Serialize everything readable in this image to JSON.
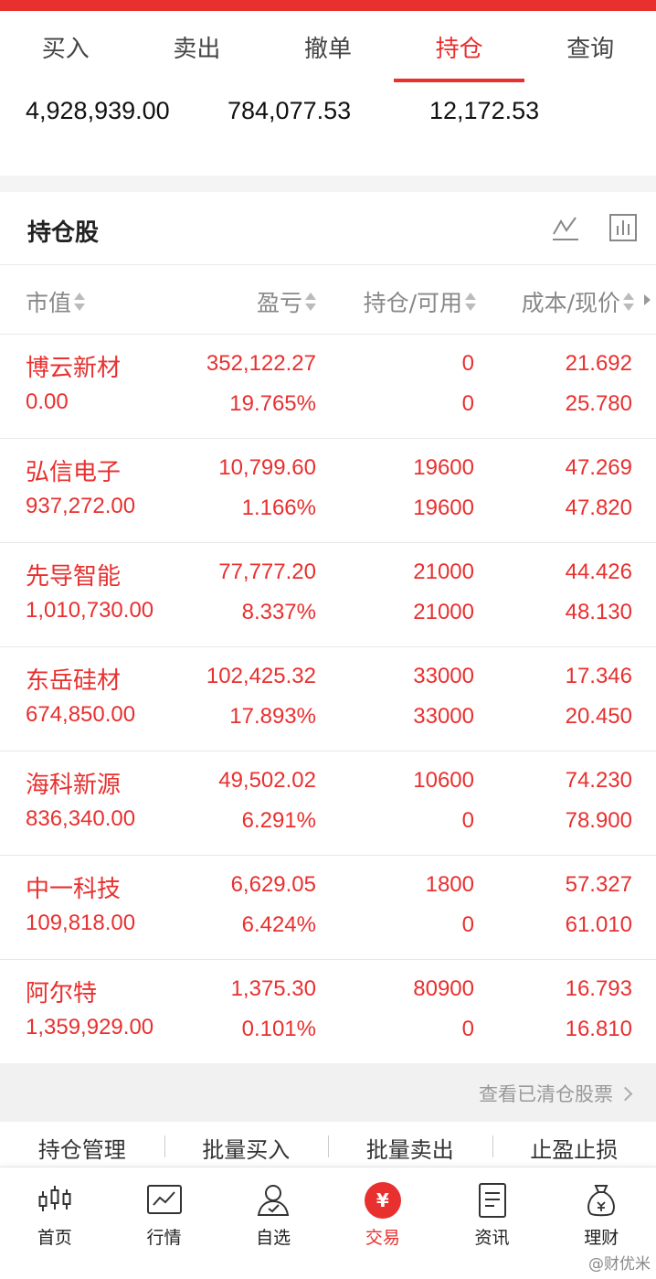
{
  "accent_color": "#e8302f",
  "tabs": [
    {
      "label": "买入"
    },
    {
      "label": "卖出"
    },
    {
      "label": "撤单"
    },
    {
      "label": "持仓",
      "active": true
    },
    {
      "label": "查询"
    }
  ],
  "summary": {
    "total_assets": "4,928,939.00",
    "market_value": "784,077.53",
    "available": "12,172.53"
  },
  "holdings": {
    "title": "持仓股",
    "icons": [
      "line-chart-icon",
      "bar-chart-icon"
    ]
  },
  "columns": {
    "market_value": "市值",
    "profit_loss": "盈亏",
    "position": "持仓/可用",
    "cost_price": "成本/现价"
  },
  "rows": [
    {
      "name": "博云新材",
      "market_value": "0.00",
      "pl": "352,122.27",
      "pl_pct": "19.765%",
      "position": "0",
      "available": "0",
      "cost": "21.692",
      "price": "25.780"
    },
    {
      "name": "弘信电子",
      "market_value": "937,272.00",
      "pl": "10,799.60",
      "pl_pct": "1.166%",
      "position": "19600",
      "available": "19600",
      "cost": "47.269",
      "price": "47.820"
    },
    {
      "name": "先导智能",
      "market_value": "1,010,730.00",
      "pl": "77,777.20",
      "pl_pct": "8.337%",
      "position": "21000",
      "available": "21000",
      "cost": "44.426",
      "price": "48.130"
    },
    {
      "name": "东岳硅材",
      "market_value": "674,850.00",
      "pl": "102,425.32",
      "pl_pct": "17.893%",
      "position": "33000",
      "available": "33000",
      "cost": "17.346",
      "price": "20.450"
    },
    {
      "name": "海科新源",
      "market_value": "836,340.00",
      "pl": "49,502.02",
      "pl_pct": "6.291%",
      "position": "10600",
      "available": "0",
      "cost": "74.230",
      "price": "78.900"
    },
    {
      "name": "中一科技",
      "market_value": "109,818.00",
      "pl": "6,629.05",
      "pl_pct": "6.424%",
      "position": "1800",
      "available": "0",
      "cost": "57.327",
      "price": "61.010"
    },
    {
      "name": "阿尔特",
      "market_value": "1,359,929.00",
      "pl": "1,375.30",
      "pl_pct": "0.101%",
      "position": "80900",
      "available": "0",
      "cost": "16.793",
      "price": "16.810"
    }
  ],
  "cleared_link": "查看已清仓股票",
  "actions": [
    "持仓管理",
    "批量买入",
    "批量卖出",
    "止盈止损"
  ],
  "bottom_nav": [
    {
      "label": "首页",
      "icon": "candlestick-icon"
    },
    {
      "label": "行情",
      "icon": "trend-chart-icon"
    },
    {
      "label": "自选",
      "icon": "user-check-icon"
    },
    {
      "label": "交易",
      "icon": "yuan-icon",
      "glyph": "¥",
      "active": true
    },
    {
      "label": "资讯",
      "icon": "document-icon"
    },
    {
      "label": "理财",
      "icon": "money-bag-icon"
    }
  ],
  "watermark": "@财优米"
}
